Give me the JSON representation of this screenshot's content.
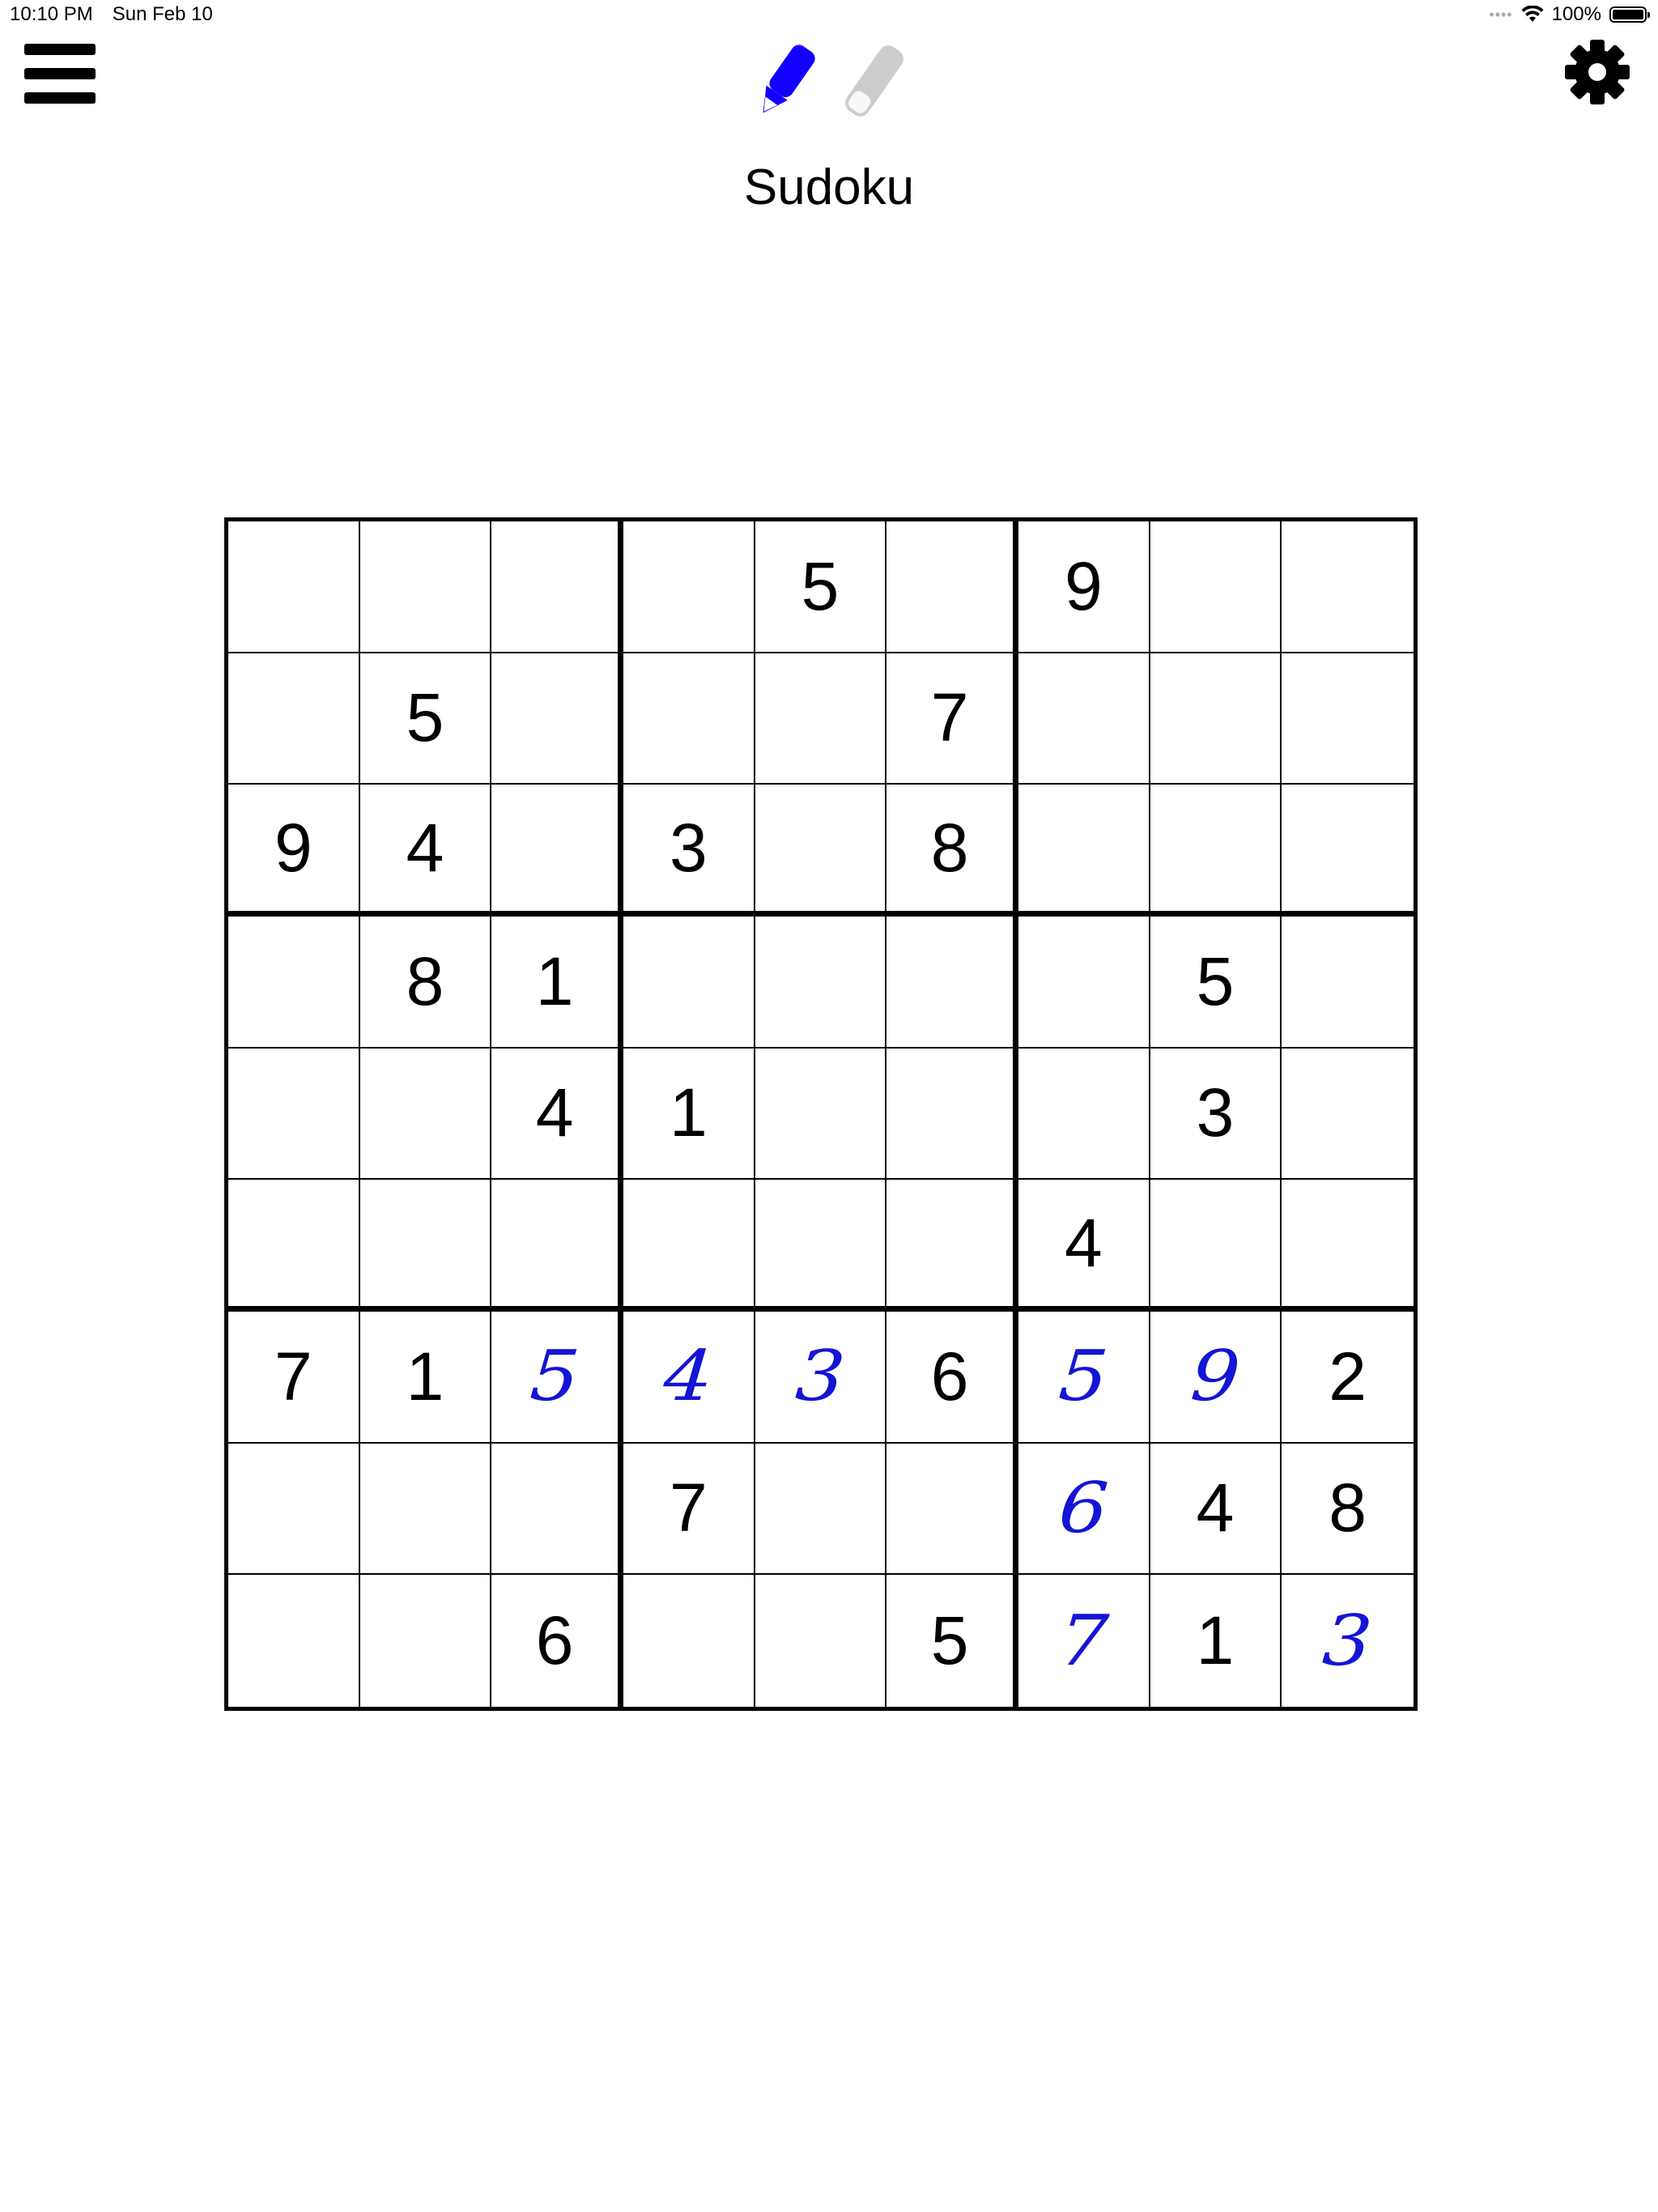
{
  "status_bar": {
    "time": "10:10 PM",
    "date": "Sun Feb 10",
    "battery": "100%"
  },
  "toolbar": {
    "menu_icon": "hamburger-menu-icon",
    "pencil_icon": "pencil-icon",
    "eraser_icon": "eraser-icon",
    "settings_icon": "gear-icon",
    "pencil_color": "#1400ff",
    "eraser_color": "#cccccc"
  },
  "title": "Sudoku",
  "board": {
    "given": [
      [
        "",
        "",
        "",
        "",
        "5",
        "",
        "9",
        "",
        ""
      ],
      [
        "",
        "5",
        "",
        "",
        "",
        "7",
        "",
        "",
        ""
      ],
      [
        "9",
        "4",
        "",
        "3",
        "",
        "8",
        "",
        "",
        ""
      ],
      [
        "",
        "8",
        "1",
        "",
        "",
        "",
        "",
        "5",
        ""
      ],
      [
        "",
        "",
        "4",
        "1",
        "",
        "",
        "",
        "3",
        ""
      ],
      [
        "",
        "",
        "",
        "",
        "",
        "",
        "4",
        "",
        ""
      ],
      [
        "7",
        "1",
        "",
        "",
        "",
        "6",
        "",
        "",
        "2"
      ],
      [
        "",
        "",
        "",
        "7",
        "",
        "",
        "",
        "4",
        "8"
      ],
      [
        "",
        "",
        "6",
        "",
        "",
        "5",
        "",
        "1",
        ""
      ]
    ],
    "entered": [
      [
        "",
        "",
        "",
        "",
        "",
        "",
        "",
        "",
        ""
      ],
      [
        "",
        "",
        "",
        "",
        "",
        "",
        "",
        "",
        ""
      ],
      [
        "",
        "",
        "",
        "",
        "",
        "",
        "",
        "",
        ""
      ],
      [
        "",
        "",
        "",
        "",
        "",
        "",
        "",
        "",
        ""
      ],
      [
        "",
        "",
        "",
        "",
        "",
        "",
        "",
        "",
        ""
      ],
      [
        "",
        "",
        "",
        "",
        "",
        "",
        "",
        "",
        ""
      ],
      [
        "",
        "",
        "5",
        "4",
        "3",
        "",
        "5",
        "9",
        ""
      ],
      [
        "",
        "",
        "",
        "",
        "",
        "",
        "6",
        "",
        ""
      ],
      [
        "",
        "",
        "",
        "",
        "",
        "",
        "7",
        "",
        "3"
      ]
    ],
    "given_color": "#000000",
    "entered_color": "#1414d6"
  }
}
